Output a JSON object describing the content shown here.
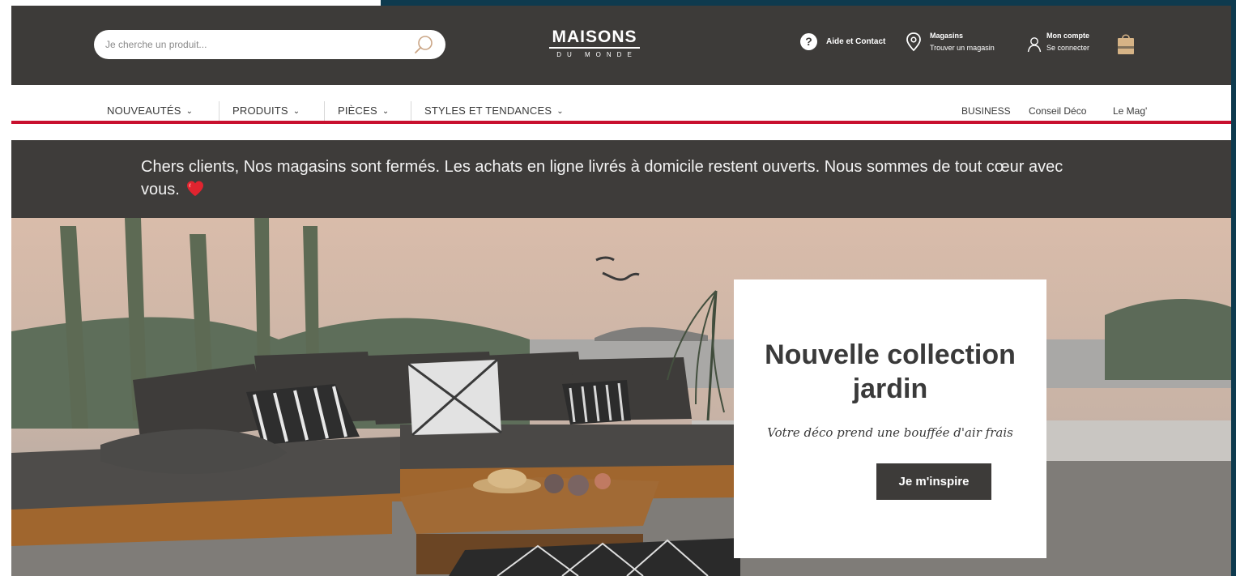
{
  "search": {
    "placeholder": "Je cherche un produit..."
  },
  "logo": {
    "main": "MAISONS",
    "sub": "DU MONDE"
  },
  "header": {
    "help_label": "Aide et Contact",
    "stores_title": "Magasins",
    "stores_sub": "Trouver un magasin",
    "account_title": "Mon compte",
    "account_sub": "Se connecter"
  },
  "nav": {
    "items": [
      {
        "label": "NOUVEAUTÉS"
      },
      {
        "label": "PRODUITS"
      },
      {
        "label": "PIÈCES"
      },
      {
        "label": "STYLES ET TENDANCES"
      }
    ],
    "right": [
      {
        "label": "BUSINESS"
      },
      {
        "label": "Conseil Déco"
      },
      {
        "label": "Le Mag'"
      }
    ]
  },
  "announcement": {
    "text": "Chers clients, Nos magasins sont fermés. Les achats en ligne livrés à domicile restent ouverts. Nous sommes de tout cœur avec vous."
  },
  "hero": {
    "title": "Nouvelle collection jardin",
    "subtitle": "Votre déco prend une bouffée d'air frais",
    "button": "Je m'inspire"
  },
  "colors": {
    "header_bg": "#3d3b39",
    "accent_red": "#c8102e",
    "frame_teal": "#0e3a4e"
  },
  "icons": {
    "search": "search-icon",
    "help": "help-icon",
    "location": "location-pin-icon",
    "user": "user-icon",
    "bag": "shopping-bag-icon",
    "heart": "heart-icon",
    "chevron": "chevron-down-icon"
  }
}
